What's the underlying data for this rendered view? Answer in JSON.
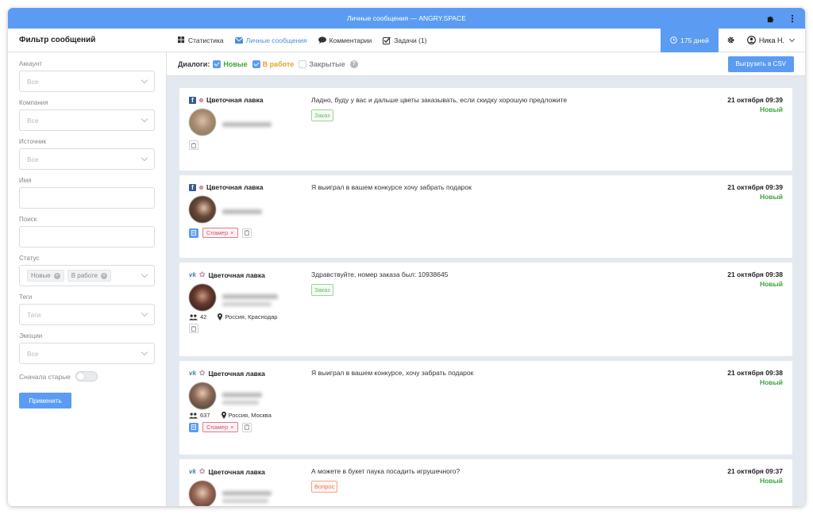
{
  "window": {
    "title": "Личные сообщения — ANGRY.SPACE"
  },
  "navbar": {
    "filter_title": "Фильтр сообщений",
    "tabs": [
      {
        "label": "Статистика",
        "icon": "grid-icon",
        "active": false
      },
      {
        "label": "Личные сообщения",
        "icon": "envelope-icon",
        "active": true
      },
      {
        "label": "Комментарии",
        "icon": "comment-icon",
        "active": false
      },
      {
        "label": "Задачи (1)",
        "icon": "checkbox-icon",
        "active": false
      }
    ],
    "days": "175 дней",
    "user": "Ника Н."
  },
  "sidebar": {
    "account": {
      "label": "Аккаунт",
      "placeholder": "Все"
    },
    "company": {
      "label": "Компания",
      "placeholder": "Все"
    },
    "source": {
      "label": "Источник",
      "placeholder": "Все"
    },
    "name": {
      "label": "Имя",
      "value": ""
    },
    "search": {
      "label": "Поиск",
      "value": ""
    },
    "status": {
      "label": "Статус",
      "chips": [
        "Новые",
        "В работе"
      ]
    },
    "tags": {
      "label": "Теги",
      "placeholder": "Теги"
    },
    "emotions": {
      "label": "Эмоции",
      "placeholder": "Все"
    },
    "old_first": "Сначала старые",
    "apply": "Применить"
  },
  "filterbar": {
    "title": "Диалоги:",
    "new": "Новые",
    "in_work": "В работе",
    "closed": "Закрытые",
    "export": "Выгрузить в CSV",
    "colors": {
      "new": "#3ca53c",
      "in_work": "#e8a02a",
      "closed": "#888888"
    }
  },
  "messages": [
    {
      "network": "facebook",
      "group": "Цветочная лавка",
      "text": "Ладно, буду у вас и дальше цветы заказывать, если скидку хорошую предложите",
      "tag": "Заказ",
      "tag_color": "green",
      "date": "21 октября 09:39",
      "status": "Новый",
      "spam": false,
      "friends": "",
      "location": ""
    },
    {
      "network": "facebook",
      "group": "Цветочная лавка",
      "text": "Я выиграл в вашем конкурсе хочу забрать подарок",
      "tag": "",
      "tag_color": "",
      "date": "21 октября 09:39",
      "status": "Новый",
      "spam": true,
      "spam_label": "Спамер",
      "friends": "",
      "location": ""
    },
    {
      "network": "vk",
      "group": "Цветочная лавка",
      "text": "Здравствуйте, номер заказа был: 10938645",
      "tag": "Заказ",
      "tag_color": "green",
      "date": "21 октября 09:38",
      "status": "Новый",
      "spam": false,
      "friends": "42",
      "location": "Россия, Краснодар"
    },
    {
      "network": "vk",
      "group": "Цветочная лавка",
      "text": "Я выиграл в вашем конкурсе, хочу забрать подарок",
      "tag": "",
      "tag_color": "",
      "date": "21 октября 09:38",
      "status": "Новый",
      "spam": true,
      "spam_label": "Спамер",
      "friends": "637",
      "location": "Россия, Москва"
    },
    {
      "network": "vk",
      "group": "Цветочная лавка",
      "text": "А можете в букет паука посадить игрушечного?",
      "tag": "Вопрос",
      "tag_color": "orange",
      "date": "21 октября 09:37",
      "status": "Новый",
      "spam": false,
      "friends": "",
      "location": ""
    }
  ]
}
